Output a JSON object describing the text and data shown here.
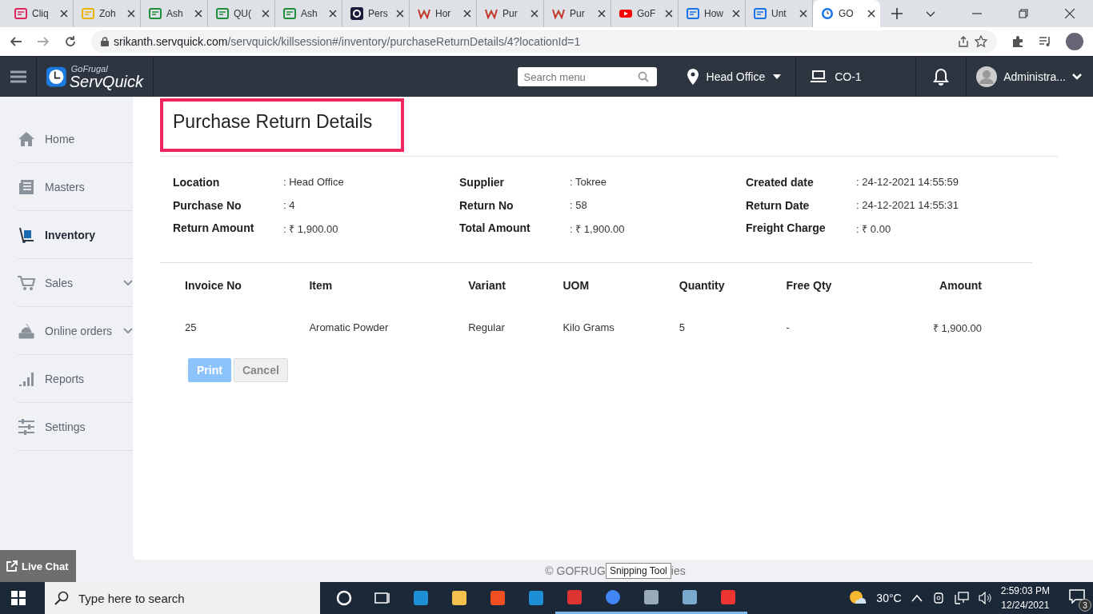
{
  "browser": {
    "tabs": [
      {
        "title": "Cliq",
        "kind": "chat",
        "selected": false
      },
      {
        "title": "Zoh",
        "kind": "folder",
        "selected": false
      },
      {
        "title": "Ash",
        "kind": "sheet",
        "selected": false
      },
      {
        "title": "QU(",
        "kind": "sheet",
        "selected": false
      },
      {
        "title": "Ash",
        "kind": "sheet",
        "selected": false
      },
      {
        "title": "Pers",
        "kind": "c",
        "selected": false
      },
      {
        "title": "Hor",
        "kind": "w",
        "selected": false
      },
      {
        "title": "Pur",
        "kind": "w",
        "selected": false
      },
      {
        "title": "Pur",
        "kind": "w",
        "selected": false
      },
      {
        "title": "GoF",
        "kind": "video",
        "selected": false
      },
      {
        "title": "How",
        "kind": "doc",
        "selected": false
      },
      {
        "title": "Unt",
        "kind": "doc",
        "selected": false
      },
      {
        "title": "GO",
        "kind": "clock",
        "selected": true
      }
    ],
    "url_host": "srikanth.servquick.com",
    "url_path": "/servquick/killsession#/inventory/purchaseReturnDetails/4?locationId=1"
  },
  "header": {
    "brand_small": "GoFrugal",
    "brand": "ServQuick",
    "search": {
      "placeholder": "Search menu"
    },
    "location": "Head Office",
    "terminal": "CO-1",
    "user": "Administra..."
  },
  "sidebar": {
    "items": [
      {
        "label": "Home",
        "selected": false,
        "has_submenu": false
      },
      {
        "label": "Masters",
        "selected": false,
        "has_submenu": false
      },
      {
        "label": "Inventory",
        "selected": true,
        "has_submenu": false
      },
      {
        "label": "Sales",
        "selected": false,
        "has_submenu": true
      },
      {
        "label": "Online orders",
        "selected": false,
        "has_submenu": true
      },
      {
        "label": "Reports",
        "selected": false,
        "has_submenu": false
      },
      {
        "label": "Settings",
        "selected": false,
        "has_submenu": false
      }
    ]
  },
  "page": {
    "title": "Purchase Return Details",
    "details": [
      [
        {
          "label": "Location",
          "value": ": Head Office"
        },
        {
          "label": "Purchase No",
          "value": ": 4"
        },
        {
          "label": "Return Amount",
          "value": ": ₹ 1,900.00"
        }
      ],
      [
        {
          "label": "Supplier",
          "value": ": Tokree"
        },
        {
          "label": "Return No",
          "value": ": 58"
        },
        {
          "label": "Total Amount",
          "value": ": ₹ 1,900.00"
        }
      ],
      [
        {
          "label": "Created date",
          "value": ": 24-12-2021 14:55:59"
        },
        {
          "label": "Return Date",
          "value": ": 24-12-2021 14:55:31"
        },
        {
          "label": "Freight Charge",
          "value": ": ₹ 0.00"
        }
      ]
    ],
    "table": {
      "columns": [
        "Invoice No",
        "Item",
        "Variant",
        "UOM",
        "Quantity",
        "Free Qty",
        "Amount"
      ],
      "rows": [
        [
          "25",
          "Aromatic Powder",
          "Regular",
          "Kilo Grams",
          "5",
          "-",
          "₹ 1,900.00"
        ]
      ]
    },
    "buttons": [
      {
        "label": "Print",
        "kind": "primary",
        "disabled": true
      },
      {
        "label": "Cancel",
        "kind": "secondary",
        "disabled": false
      }
    ]
  },
  "footer": {
    "left": "© GOFRUG",
    "right": "ies"
  },
  "tooltip": "Snipping Tool",
  "live_chat": "Live Chat",
  "taskbar": {
    "search": {
      "placeholder": "Type here to search"
    },
    "apps": [
      {
        "running": false
      },
      {
        "running": false
      },
      {
        "running": false
      },
      {
        "running": false
      },
      {
        "running": false
      },
      {
        "running": false
      },
      {
        "running": true
      },
      {
        "running": true
      },
      {
        "running": true
      },
      {
        "running": true
      },
      {
        "running": true
      }
    ],
    "temperature": "30°C",
    "time": "2:59:03 PM",
    "date": "12/24/2021",
    "notifications": "3"
  }
}
